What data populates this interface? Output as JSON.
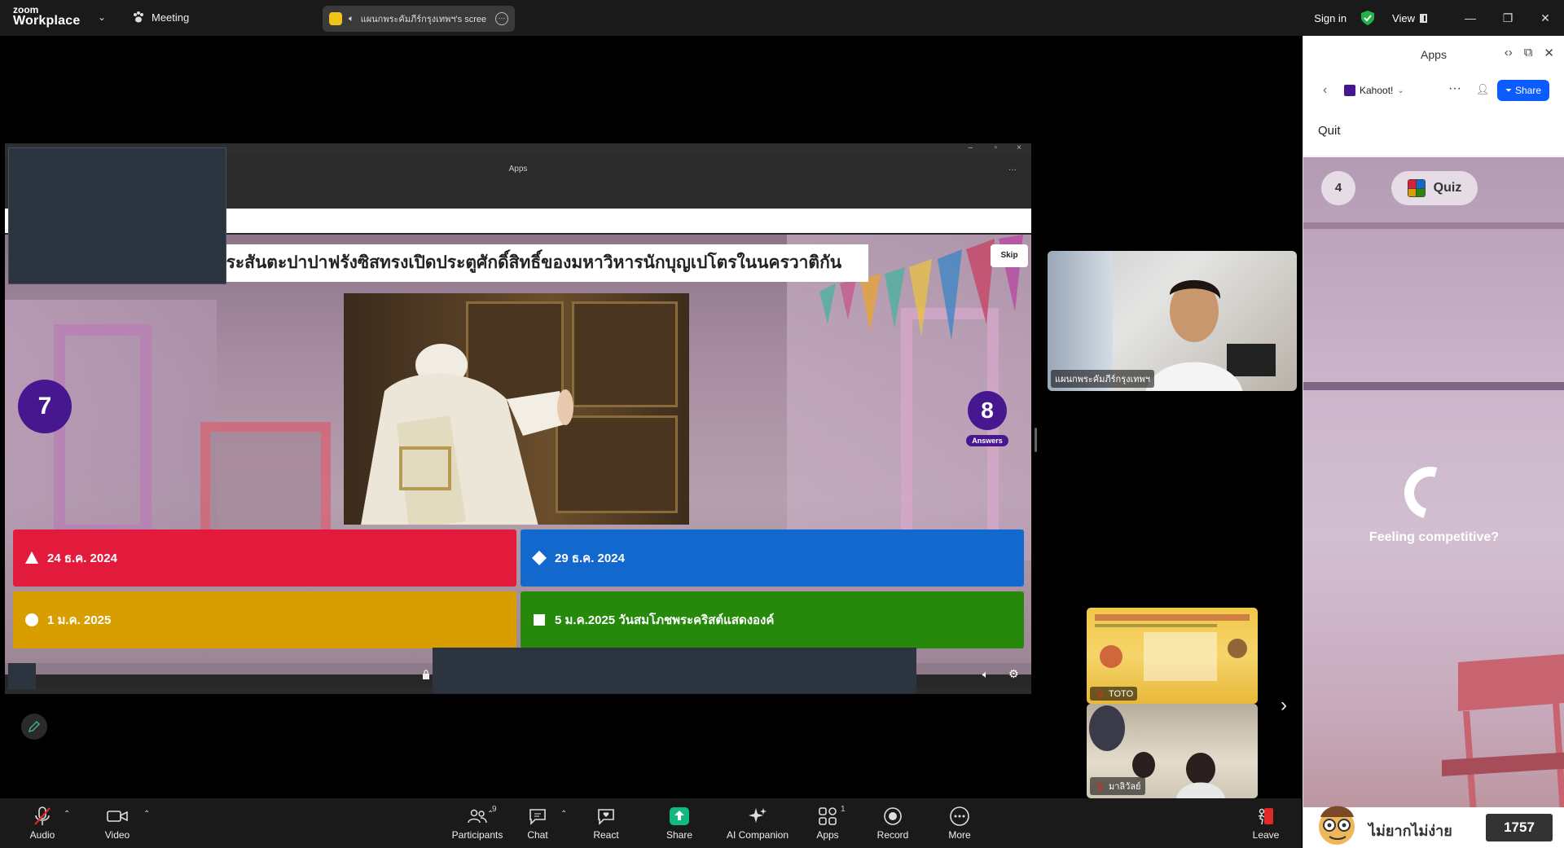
{
  "titlebar": {
    "logo_line1": "zoom",
    "logo_line2": "Workplace",
    "meeting_label": "Meeting",
    "share_pill_text": "แผนกพระคัมภีร์กรุงเทพฯ's scree",
    "signin": "Sign in",
    "view": "View"
  },
  "shared_window": {
    "apps_title": "Apps",
    "more": "···"
  },
  "kahoot_game": {
    "question": "ใดที่พระสันตะปาปาฟรังซิสทรงเปิดประตูศักดิ์สิทธิ์ของมหาวิหารนักบุญเปโตรในนครวาติกัน",
    "skip": "Skip",
    "timer": "7",
    "answers_count": "8",
    "answers_label": "Answers",
    "answers": [
      {
        "text": "24 ธ.ค. 2024",
        "color": "#e21b3c",
        "shape": "triangle"
      },
      {
        "text": "29 ธ.ค. 2024",
        "color": "#1368ce",
        "shape": "diamond"
      },
      {
        "text": "1 ม.ค. 2025",
        "color": "#d89e00",
        "shape": "circle"
      },
      {
        "text": "5 ม.ค.2025 วันสมโภชพระคริสต์แสดงองค์",
        "color": "#26890c",
        "shape": "square"
      }
    ]
  },
  "video_tiles": {
    "main_name": "แผนกพระคัมภีร์กรุงเทพฯ",
    "mini1_name": "TOTO",
    "mini2_name": "มาลิวัลย์"
  },
  "toolbar": {
    "audio": "Audio",
    "video": "Video",
    "participants": "Participants",
    "participants_count": "9",
    "chat": "Chat",
    "react": "React",
    "share": "Share",
    "ai_companion": "AI Companion",
    "apps": "Apps",
    "apps_count": "1",
    "record": "Record",
    "more": "More",
    "leave": "Leave"
  },
  "panel": {
    "title": "Apps",
    "app_name": "Kahoot!",
    "share": "Share",
    "quit": "Quit",
    "question_number": "4",
    "quiz_label": "Quiz",
    "feeling": "Feeling competitive?",
    "player_name": "ไม่ยากไม่ง่าย",
    "score": "1757"
  },
  "colors": {
    "kahoot_purple": "#46178f",
    "zoom_blue": "#0b5cff",
    "share_green": "#10b981"
  }
}
